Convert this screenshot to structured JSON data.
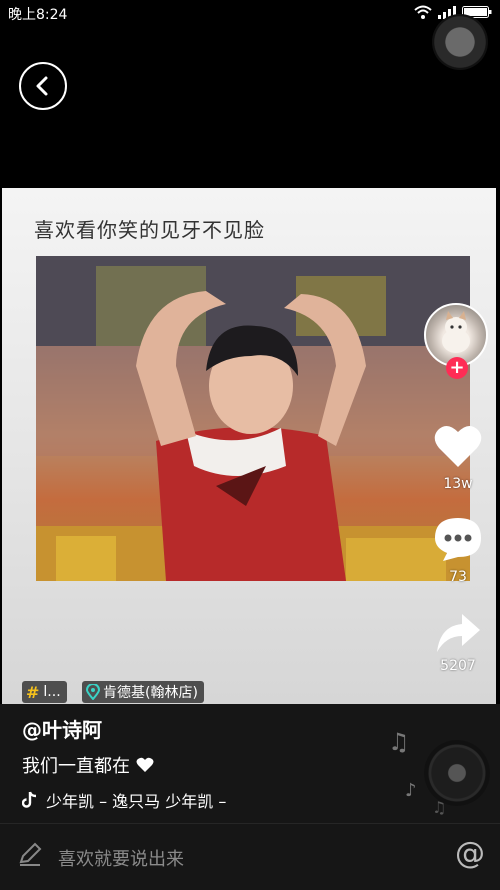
{
  "status_bar": {
    "time": "晚上8:24"
  },
  "video": {
    "caption": "喜欢看你笑的见牙不见脸"
  },
  "actions": {
    "like_count": "13w",
    "comment_count": "73",
    "share_count": "5207"
  },
  "tags": {
    "topic_label": "l...",
    "location_label": "肯德基(翰林店)"
  },
  "post": {
    "username": "@叶诗阿",
    "description": "我们一直都在",
    "music_text": "少年凯 – 逸只马    少年凯 –"
  },
  "comment_bar": {
    "placeholder": "喜欢就要说出来",
    "mention_symbol": "@"
  },
  "icons": {
    "back": "chevron-left-icon",
    "like": "heart-icon",
    "comment": "speech-bubble-icon",
    "share": "share-arrow-icon",
    "music": "tiktok-note-icon",
    "location": "location-pin-icon",
    "topic": "hashtag-icon",
    "compose": "pencil-icon"
  },
  "colors": {
    "follow_accent": "#fe2c55",
    "topic_hash": "#f6c21c",
    "location_pin": "#39d3c6"
  }
}
